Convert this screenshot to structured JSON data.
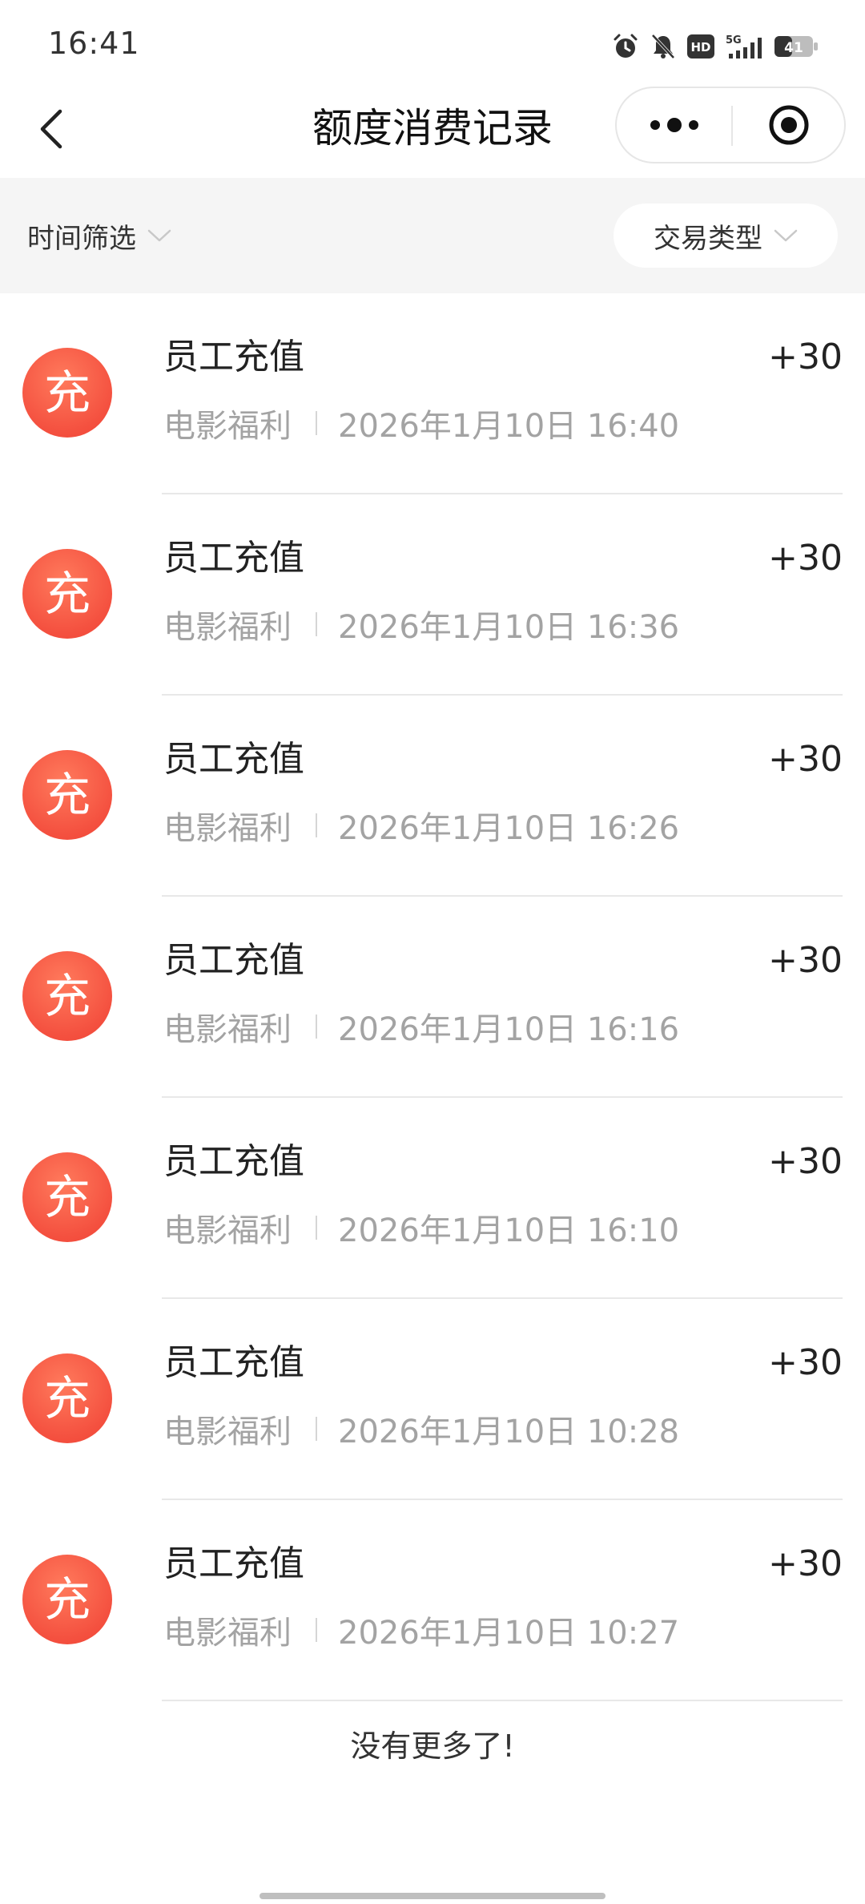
{
  "status_bar": {
    "time": "16:41",
    "battery": "41",
    "network": "5G",
    "hd": "HD",
    "icons": [
      "alarm-icon",
      "mute-icon",
      "hd-icon",
      "signal-5g-icon",
      "battery-icon"
    ]
  },
  "nav": {
    "title": "额度消费记录",
    "back_icon": "chevron-left-icon",
    "more_icon": "more-dots-icon",
    "close_icon": "target-close-icon"
  },
  "filters": {
    "time_label": "时间筛选",
    "type_label": "交易类型"
  },
  "records": [
    {
      "title": "员工充值",
      "category": "电影福利",
      "datetime": "2026年1月10日 16:40",
      "amount": "+30",
      "badge": "充"
    },
    {
      "title": "员工充值",
      "category": "电影福利",
      "datetime": "2026年1月10日 16:36",
      "amount": "+30",
      "badge": "充"
    },
    {
      "title": "员工充值",
      "category": "电影福利",
      "datetime": "2026年1月10日 16:26",
      "amount": "+30",
      "badge": "充"
    },
    {
      "title": "员工充值",
      "category": "电影福利",
      "datetime": "2026年1月10日 16:16",
      "amount": "+30",
      "badge": "充"
    },
    {
      "title": "员工充值",
      "category": "电影福利",
      "datetime": "2026年1月10日 16:10",
      "amount": "+30",
      "badge": "充"
    },
    {
      "title": "员工充值",
      "category": "电影福利",
      "datetime": "2026年1月10日 10:28",
      "amount": "+30",
      "badge": "充"
    },
    {
      "title": "员工充值",
      "category": "电影福利",
      "datetime": "2026年1月10日 10:27",
      "amount": "+30",
      "badge": "充"
    }
  ],
  "footer": {
    "no_more": "没有更多了!"
  },
  "colors": {
    "accent": "#f4503f",
    "filter_bg": "#f5f5f5",
    "subtext": "#a3a3a3"
  }
}
